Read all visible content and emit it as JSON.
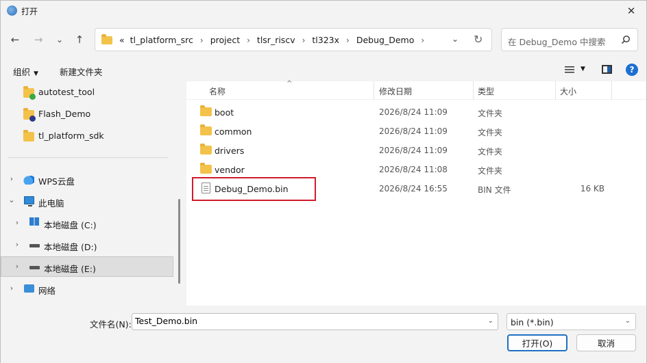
{
  "window": {
    "title": "打开",
    "close_glyph": "✕"
  },
  "nav": {
    "back": "←",
    "forward": "→",
    "recent": "⌄",
    "up": "↑",
    "address_crumbs": [
      "«",
      "tl_platform_src",
      "project",
      "tlsr_riscv",
      "tl323x",
      "Debug_Demo"
    ],
    "crumb_sep": "›",
    "address_dropdown": "⌄",
    "refresh": "↻",
    "search_placeholder": "在 Debug_Demo 中搜索"
  },
  "toolbar": {
    "organize": "组织",
    "new_folder": "新建文件夹",
    "caret": "▼",
    "help": "?"
  },
  "navpane": {
    "items": [
      {
        "label": "autotest_tool",
        "icon": "folder-check-icon",
        "chevron": ""
      },
      {
        "label": "Flash_Demo",
        "icon": "folder-question-icon",
        "chevron": ""
      },
      {
        "label": "tl_platform_sdk",
        "icon": "folder-icon",
        "chevron": ""
      },
      {
        "label": "WPS云盘",
        "icon": "cloud-icon",
        "chevron": "›"
      },
      {
        "label": "此电脑",
        "icon": "computer-icon",
        "chevron": "⌄"
      },
      {
        "label": "本地磁盘 (C:)",
        "icon": "windows-drive-icon",
        "chevron": "›"
      },
      {
        "label": "本地磁盘 (D:)",
        "icon": "drive-icon",
        "chevron": "›"
      },
      {
        "label": "本地磁盘 (E:)",
        "icon": "drive-icon",
        "chevron": "›"
      },
      {
        "label": "网络",
        "icon": "network-icon",
        "chevron": "›"
      }
    ]
  },
  "filelist": {
    "columns": {
      "name": "名称",
      "date": "修改日期",
      "type": "类型",
      "size": "大小"
    },
    "sort_glyph": "^",
    "rows": [
      {
        "name": "boot",
        "date": "2026/8/24 11:09",
        "type": "文件夹",
        "size": ""
      },
      {
        "name": "common",
        "date": "2026/8/24 11:09",
        "type": "文件夹",
        "size": ""
      },
      {
        "name": "drivers",
        "date": "2026/8/24 11:09",
        "type": "文件夹",
        "size": ""
      },
      {
        "name": "vendor",
        "date": "2026/8/24 11:08",
        "type": "文件夹",
        "size": ""
      },
      {
        "name": "Debug_Demo.bin",
        "date": "2026/8/24 16:55",
        "type": "BIN 文件",
        "size": "16 KB"
      }
    ]
  },
  "bottom": {
    "filename_label": "文件名(N):",
    "filename_value": "Test_Demo.bin",
    "filter_value": "bin (*.bin)",
    "open_label": "打开(O)",
    "cancel_label": "取消",
    "caret": "⌄"
  },
  "colors": {
    "highlight": "#d11a2a",
    "accent": "#1f6fc2",
    "folder": "#f3c24a"
  }
}
